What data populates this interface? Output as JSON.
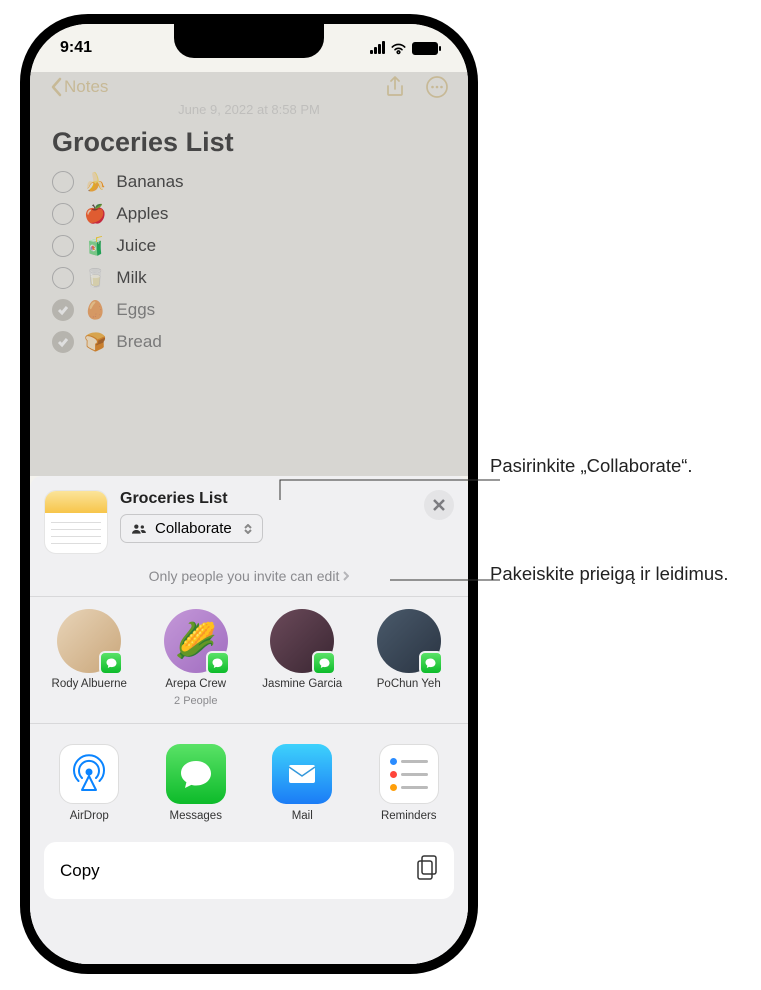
{
  "status": {
    "time": "9:41"
  },
  "nav": {
    "back": "Notes"
  },
  "note": {
    "timestamp": "June 9, 2022 at 8:58 PM",
    "title": "Groceries List",
    "items": [
      {
        "emoji": "🍌",
        "text": "Bananas",
        "checked": false
      },
      {
        "emoji": "🍎",
        "text": "Apples",
        "checked": false
      },
      {
        "emoji": "🧃",
        "text": "Juice",
        "checked": false
      },
      {
        "emoji": "🥛",
        "text": "Milk",
        "checked": false
      },
      {
        "emoji": "🥚",
        "text": "Eggs",
        "checked": true
      },
      {
        "emoji": "🍞",
        "text": "Bread",
        "checked": true
      }
    ]
  },
  "share": {
    "title": "Groceries List",
    "mode": "Collaborate",
    "permissions": "Only people you invite can edit",
    "contacts": [
      {
        "name": "Rody Albuerne",
        "sub": ""
      },
      {
        "name": "Arepa Crew",
        "sub": "2 People"
      },
      {
        "name": "Jasmine Garcia",
        "sub": ""
      },
      {
        "name": "PoChun Yeh",
        "sub": ""
      }
    ],
    "apps": [
      {
        "label": "AirDrop"
      },
      {
        "label": "Messages"
      },
      {
        "label": "Mail"
      },
      {
        "label": "Reminders"
      }
    ],
    "copy": "Copy"
  },
  "callouts": {
    "c1": "Pasirinkite „Collaborate“.",
    "c2": "Pakeiskite prieigą ir leidimus."
  }
}
